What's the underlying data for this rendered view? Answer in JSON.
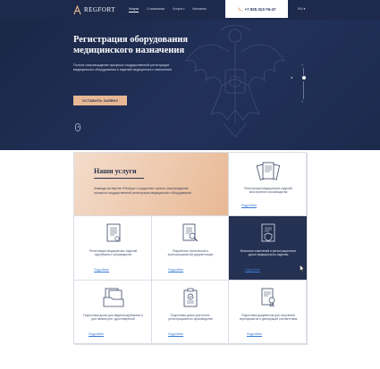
{
  "header": {
    "logo_text": "REGFORT",
    "nav": [
      {
        "label": "Услуги",
        "active": true
      },
      {
        "label": "О компании",
        "active": false
      },
      {
        "label": "Услуги",
        "active": false,
        "has_dropdown": true
      },
      {
        "label": "Контакты",
        "active": false
      }
    ],
    "phone": "+7 925 313-76-47",
    "language": "RU"
  },
  "hero": {
    "title": "Регистрация оборудования медицинского назначения",
    "subtitle": "Полное сопровождение процесса государственной регистрации медицинского оборудования и изделий медицинского назначения",
    "cta_label": "ОСТАВИТЬ ЗАЯВКУ"
  },
  "services": {
    "title": "Наши услуги",
    "description": "Команда экспертов «Регфорт» осуществит полное сопровождение процесса государственной регистрации медицинского оборудования",
    "cards": [
      {
        "text": "Регистрация медицинских изделий иностранного производства",
        "link": "Подробнее",
        "icon": "documents-icon"
      },
      {
        "text": "Регистрация медицинских изделий зарубежного производства",
        "link": "Подробнее",
        "icon": "document-icon"
      },
      {
        "text": "Разработка технической и эксплуатационной документации",
        "link": "Подробнее",
        "icon": "document-search-icon"
      },
      {
        "text": "Внесение изменений в регистрационное досье медицинского изделия",
        "link": "Подробнее",
        "icon": "document-shield-icon",
        "highlighted": true
      },
      {
        "text": "Подготовка досье для ведения дубликата и для замены рег. удостоверений",
        "link": "Подробнее",
        "icon": "folder-documents-icon"
      },
      {
        "text": "Подготовка досье для после-регистрационного производства",
        "link": "Подробнее",
        "icon": "clipboard-check-icon"
      },
      {
        "text": "Подготовка документов для получения сертификатов и деклараций соответствия",
        "link": "Подробнее",
        "icon": "certificate-icon"
      }
    ]
  },
  "colors": {
    "hero_bg": "#1a2644",
    "accent": "#e8b894",
    "highlight_card": "#253152",
    "link": "#3a7bd5"
  }
}
